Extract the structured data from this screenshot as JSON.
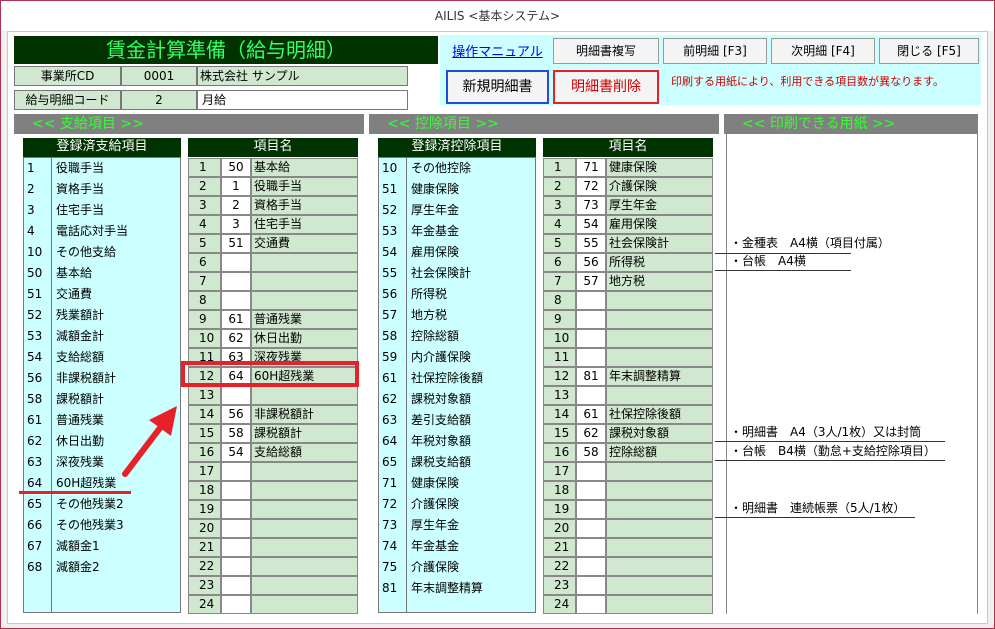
{
  "window_title": "AILIS <基本システム>",
  "header": {
    "title": "賃金計算準備（給与明細）",
    "office_label": "事業所CD",
    "office_code": "0001",
    "office_name": "株式会社 サンプル",
    "slip_label": "給与明細コード",
    "slip_code": "2",
    "slip_name": "月給"
  },
  "toolbar": {
    "manual_link": "操作マニュアル",
    "copy_button": "明細書複写",
    "prev_button": "前明細 [F3]",
    "next_button": "次明細 [F4]",
    "close_button": "閉じる [F5]",
    "new_button": "新規明細書",
    "delete_button": "明細書削除",
    "notice": "印刷する用紙により、利用できる項目数が異なります。"
  },
  "payment": {
    "section_title": "<< 支給項目 >>",
    "registered_header": "登録済支給項目",
    "item_header": "項目名",
    "registered": [
      {
        "code": "1",
        "name": "役職手当"
      },
      {
        "code": "2",
        "name": "資格手当"
      },
      {
        "code": "3",
        "name": "住宅手当"
      },
      {
        "code": "4",
        "name": "電話応対手当"
      },
      {
        "code": "10",
        "name": "その他支給"
      },
      {
        "code": "50",
        "name": "基本給"
      },
      {
        "code": "51",
        "name": "交通費"
      },
      {
        "code": "52",
        "name": "残業額計"
      },
      {
        "code": "53",
        "name": "減額金計"
      },
      {
        "code": "54",
        "name": "支給総額"
      },
      {
        "code": "56",
        "name": "非課税額計"
      },
      {
        "code": "58",
        "name": "課税額計"
      },
      {
        "code": "61",
        "name": "普通残業"
      },
      {
        "code": "62",
        "name": "休日出勤"
      },
      {
        "code": "63",
        "name": "深夜残業"
      },
      {
        "code": "64",
        "name": "60H超残業"
      },
      {
        "code": "65",
        "name": "その他残業2"
      },
      {
        "code": "66",
        "name": "その他残業3"
      },
      {
        "code": "67",
        "name": "減額金1"
      },
      {
        "code": "68",
        "name": "減額金2"
      }
    ],
    "items": [
      {
        "no": "1",
        "code": "50",
        "name": "基本給"
      },
      {
        "no": "2",
        "code": "1",
        "name": "役職手当"
      },
      {
        "no": "3",
        "code": "2",
        "name": "資格手当"
      },
      {
        "no": "4",
        "code": "3",
        "name": "住宅手当"
      },
      {
        "no": "5",
        "code": "51",
        "name": "交通費"
      },
      {
        "no": "6",
        "code": "",
        "name": ""
      },
      {
        "no": "7",
        "code": "",
        "name": ""
      },
      {
        "no": "8",
        "code": "",
        "name": ""
      },
      {
        "no": "9",
        "code": "61",
        "name": "普通残業"
      },
      {
        "no": "10",
        "code": "62",
        "name": "休日出勤"
      },
      {
        "no": "11",
        "code": "63",
        "name": "深夜残業"
      },
      {
        "no": "12",
        "code": "64",
        "name": "60H超残業"
      },
      {
        "no": "13",
        "code": "",
        "name": ""
      },
      {
        "no": "14",
        "code": "56",
        "name": "非課税額計"
      },
      {
        "no": "15",
        "code": "58",
        "name": "課税額計"
      },
      {
        "no": "16",
        "code": "54",
        "name": "支給総額"
      },
      {
        "no": "17",
        "code": "",
        "name": ""
      },
      {
        "no": "18",
        "code": "",
        "name": ""
      },
      {
        "no": "19",
        "code": "",
        "name": ""
      },
      {
        "no": "20",
        "code": "",
        "name": ""
      },
      {
        "no": "21",
        "code": "",
        "name": ""
      },
      {
        "no": "22",
        "code": "",
        "name": ""
      },
      {
        "no": "23",
        "code": "",
        "name": ""
      },
      {
        "no": "24",
        "code": "",
        "name": ""
      }
    ]
  },
  "deduction": {
    "section_title": "<< 控除項目 >>",
    "registered_header": "登録済控除項目",
    "item_header": "項目名",
    "registered": [
      {
        "code": "10",
        "name": "その他控除"
      },
      {
        "code": "51",
        "name": "健康保険"
      },
      {
        "code": "52",
        "name": "厚生年金"
      },
      {
        "code": "53",
        "name": "年金基金"
      },
      {
        "code": "54",
        "name": "雇用保険"
      },
      {
        "code": "55",
        "name": "社会保険計"
      },
      {
        "code": "56",
        "name": "所得税"
      },
      {
        "code": "57",
        "name": "地方税"
      },
      {
        "code": "58",
        "name": "控除総額"
      },
      {
        "code": "59",
        "name": "内介護保険"
      },
      {
        "code": "61",
        "name": "社保控除後額"
      },
      {
        "code": "62",
        "name": "課税対象額"
      },
      {
        "code": "63",
        "name": "差引支給額"
      },
      {
        "code": "64",
        "name": "年税対象額"
      },
      {
        "code": "65",
        "name": "課税支給額"
      },
      {
        "code": "71",
        "name": "健康保険"
      },
      {
        "code": "72",
        "name": "介護保険"
      },
      {
        "code": "73",
        "name": "厚生年金"
      },
      {
        "code": "74",
        "name": "年金基金"
      },
      {
        "code": "75",
        "name": "介護保険"
      },
      {
        "code": "81",
        "name": "年末調整精算"
      }
    ],
    "items": [
      {
        "no": "1",
        "code": "71",
        "name": "健康保険"
      },
      {
        "no": "2",
        "code": "72",
        "name": "介護保険"
      },
      {
        "no": "3",
        "code": "73",
        "name": "厚生年金"
      },
      {
        "no": "4",
        "code": "54",
        "name": "雇用保険"
      },
      {
        "no": "5",
        "code": "55",
        "name": "社会保険計"
      },
      {
        "no": "6",
        "code": "56",
        "name": "所得税"
      },
      {
        "no": "7",
        "code": "57",
        "name": "地方税"
      },
      {
        "no": "8",
        "code": "",
        "name": ""
      },
      {
        "no": "9",
        "code": "",
        "name": ""
      },
      {
        "no": "10",
        "code": "",
        "name": ""
      },
      {
        "no": "11",
        "code": "",
        "name": ""
      },
      {
        "no": "12",
        "code": "81",
        "name": "年末調整精算"
      },
      {
        "no": "13",
        "code": "",
        "name": ""
      },
      {
        "no": "14",
        "code": "61",
        "name": "社保控除後額"
      },
      {
        "no": "15",
        "code": "62",
        "name": "課税対象額"
      },
      {
        "no": "16",
        "code": "58",
        "name": "控除総額"
      },
      {
        "no": "17",
        "code": "",
        "name": ""
      },
      {
        "no": "18",
        "code": "",
        "name": ""
      },
      {
        "no": "19",
        "code": "",
        "name": ""
      },
      {
        "no": "20",
        "code": "",
        "name": ""
      },
      {
        "no": "21",
        "code": "",
        "name": ""
      },
      {
        "no": "22",
        "code": "",
        "name": ""
      },
      {
        "no": "23",
        "code": "",
        "name": ""
      },
      {
        "no": "24",
        "code": "",
        "name": ""
      }
    ]
  },
  "printable": {
    "section_title": "<< 印刷できる用紙 >>",
    "notes": [
      "・金種表　A4横（項目付属）",
      "・台帳　A4横",
      "・明細書　A4（3人/1枚）又は封筒",
      "・台帳　B4横（勤怠+支給控除項目）",
      "・明細書　連続帳票（5人/1枚）"
    ]
  },
  "colors": {
    "title_bg": "#003300",
    "title_fg": "#33ff66",
    "highlight": "#e8202a",
    "cyan": "#ccffff",
    "green_cell": "#cfe8cf"
  }
}
